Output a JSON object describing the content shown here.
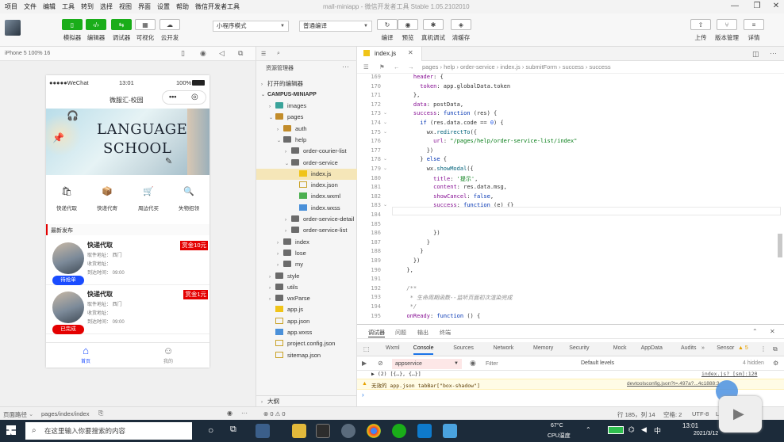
{
  "menu": [
    "项目",
    "文件",
    "编辑",
    "工具",
    "转到",
    "选择",
    "视图",
    "界面",
    "设置",
    "帮助",
    "微信开发者工具"
  ],
  "window_title": "mall-miniapp - 微信开发者工具 Stable 1.05.2102010",
  "toolbar": {
    "simulator": "模拟器",
    "editor": "编辑器",
    "debugger": "调试器",
    "visual": "可视化",
    "cloud": "云开发",
    "mode_select": "小程序模式",
    "compile_select": "普通编译",
    "compile": "编译",
    "preview": "预览",
    "real_debug": "真机调试",
    "clear_cache": "清缓存",
    "upload": "上传",
    "version": "版本管理",
    "details": "详情"
  },
  "device": "iPhone 5 100% 16",
  "phone": {
    "carrier": "●●●●●WeChat",
    "time": "13:01",
    "battery": "100%",
    "nav_title": "微服汇-校园",
    "banner_line1": "LANGUAGE",
    "banner_line2": "SCHOOL",
    "categories": [
      "快递代取",
      "快递代寄",
      "周边代买",
      "失物招领"
    ],
    "section_title": "最新发布",
    "orders": [
      {
        "title": "快递代取",
        "bounty": "赏金10元",
        "pickup": "取件地址：  西门",
        "receive": "收货地址：",
        "arrive": "到达时间：  09:00",
        "state": "待抢单"
      },
      {
        "title": "快递代取",
        "bounty": "赏金1元",
        "pickup": "取件地址：  西门",
        "receive": "收货地址：",
        "arrive": "到达时间：  09:00",
        "state": "已完成"
      }
    ],
    "tab_home": "首页",
    "tab_mine": "我的"
  },
  "explorer": {
    "title": "资源管理器",
    "open_editors": "打开的编辑器",
    "project": "CAMPUS-MINIAPP",
    "outline": "大纲",
    "tree": [
      {
        "name": "images",
        "depth": 1,
        "type": "folder-teal",
        "arrow": "›"
      },
      {
        "name": "pages",
        "depth": 1,
        "type": "folder-open",
        "arrow": "⌄"
      },
      {
        "name": "auth",
        "depth": 2,
        "type": "folder-open",
        "arrow": "›"
      },
      {
        "name": "help",
        "depth": 2,
        "type": "folder",
        "arrow": "⌄"
      },
      {
        "name": "order-courier-list",
        "depth": 3,
        "type": "folder",
        "arrow": "›"
      },
      {
        "name": "order-service",
        "depth": 3,
        "type": "folder",
        "arrow": "⌄"
      },
      {
        "name": "index.js",
        "depth": 4,
        "type": "js",
        "arrow": ""
      },
      {
        "name": "index.json",
        "depth": 4,
        "type": "json",
        "arrow": ""
      },
      {
        "name": "index.wxml",
        "depth": 4,
        "type": "wxml",
        "arrow": ""
      },
      {
        "name": "index.wxss",
        "depth": 4,
        "type": "wxss",
        "arrow": ""
      },
      {
        "name": "order-service-detail",
        "depth": 3,
        "type": "folder",
        "arrow": "›"
      },
      {
        "name": "order-service-list",
        "depth": 3,
        "type": "folder",
        "arrow": "›"
      },
      {
        "name": "index",
        "depth": 2,
        "type": "folder",
        "arrow": "›"
      },
      {
        "name": "lose",
        "depth": 2,
        "type": "folder",
        "arrow": "›"
      },
      {
        "name": "my",
        "depth": 2,
        "type": "folder",
        "arrow": "›"
      },
      {
        "name": "style",
        "depth": 1,
        "type": "folder",
        "arrow": "›"
      },
      {
        "name": "utils",
        "depth": 1,
        "type": "folder",
        "arrow": "›"
      },
      {
        "name": "wxParse",
        "depth": 1,
        "type": "folder",
        "arrow": "›"
      },
      {
        "name": "app.js",
        "depth": 1,
        "type": "js",
        "arrow": ""
      },
      {
        "name": "app.json",
        "depth": 1,
        "type": "json",
        "arrow": ""
      },
      {
        "name": "app.wxss",
        "depth": 1,
        "type": "wxss",
        "arrow": ""
      },
      {
        "name": "project.config.json",
        "depth": 1,
        "type": "json",
        "arrow": ""
      },
      {
        "name": "sitemap.json",
        "depth": 1,
        "type": "json",
        "arrow": ""
      }
    ]
  },
  "editor": {
    "tab": "index.js",
    "breadcrumb": [
      "pages",
      "help",
      "order-service",
      "index.js",
      "submitForm",
      "success",
      "success"
    ],
    "lines": [
      {
        "n": "169",
        "html": "    header: {"
      },
      {
        "n": "170",
        "html": "      token: app.globalData.token"
      },
      {
        "n": "171",
        "html": "    },"
      },
      {
        "n": "172",
        "html": "    data: postData,"
      },
      {
        "n": "173",
        "html": "    success: function (res) {"
      },
      {
        "n": "174",
        "html": "      if (res.data.code == 0) {"
      },
      {
        "n": "175",
        "html": "        wx.redirectTo({"
      },
      {
        "n": "176",
        "html": "          url: \"/pages/help/order-service-list/index\""
      },
      {
        "n": "177",
        "html": "        })"
      },
      {
        "n": "178",
        "html": "      } else {"
      },
      {
        "n": "179",
        "html": "        wx.showModal({"
      },
      {
        "n": "180",
        "html": "          title: '提示',"
      },
      {
        "n": "181",
        "html": "          content: res.data.msg,"
      },
      {
        "n": "182",
        "html": "          showCancel: false,"
      },
      {
        "n": "183",
        "html": "          success: function (e) {}"
      },
      {
        "n": "184",
        "html": ""
      },
      {
        "n": "185",
        "html": ""
      },
      {
        "n": "186",
        "html": "          })"
      },
      {
        "n": "187",
        "html": "        }"
      },
      {
        "n": "188",
        "html": "      }"
      },
      {
        "n": "189",
        "html": "    })"
      },
      {
        "n": "190",
        "html": "  },"
      },
      {
        "n": "191",
        "html": ""
      },
      {
        "n": "192",
        "html": "  /**"
      },
      {
        "n": "193",
        "html": "   * 生命周期函数--监听页面初次渲染完成"
      },
      {
        "n": "194",
        "html": "   */"
      },
      {
        "n": "195",
        "html": "  onReady: function () {"
      }
    ]
  },
  "console": {
    "panel_tabs": [
      "调试器",
      "问题",
      "输出",
      "终端"
    ],
    "tabs": [
      "Wxml",
      "Console",
      "Sources",
      "Network",
      "Memory",
      "Security",
      "Mock",
      "AppData",
      "Audits",
      "Sensor"
    ],
    "warn_count": "5",
    "context": "appservice",
    "filter_placeholder": "Filter",
    "levels": "Default levels",
    "hidden": "4 hidden",
    "row1": "▶ (2) [{…}, {…}]",
    "row1_src": "index.js? [sm]:120",
    "row2": "无效的 app.json tabBar[\"box-shadow\"]",
    "row2_src": "devtoolsconfig.json?t=.497a?...4c1888:3"
  },
  "statusbar": {
    "path_label": "页面路径",
    "path": "pages/index/index",
    "errors": "⊗ 0 ⚠ 0",
    "position": "行 185，列 14",
    "spaces": "空格: 2",
    "encoding": "UTF-8",
    "eol": "LF",
    "lang": "JavaScript"
  },
  "taskbar": {
    "search_placeholder": "在这里输入你要搜索的内容",
    "temp": "67°C",
    "cpu": "CPU温度",
    "clock": "13:01",
    "date": "2021/3/12"
  }
}
